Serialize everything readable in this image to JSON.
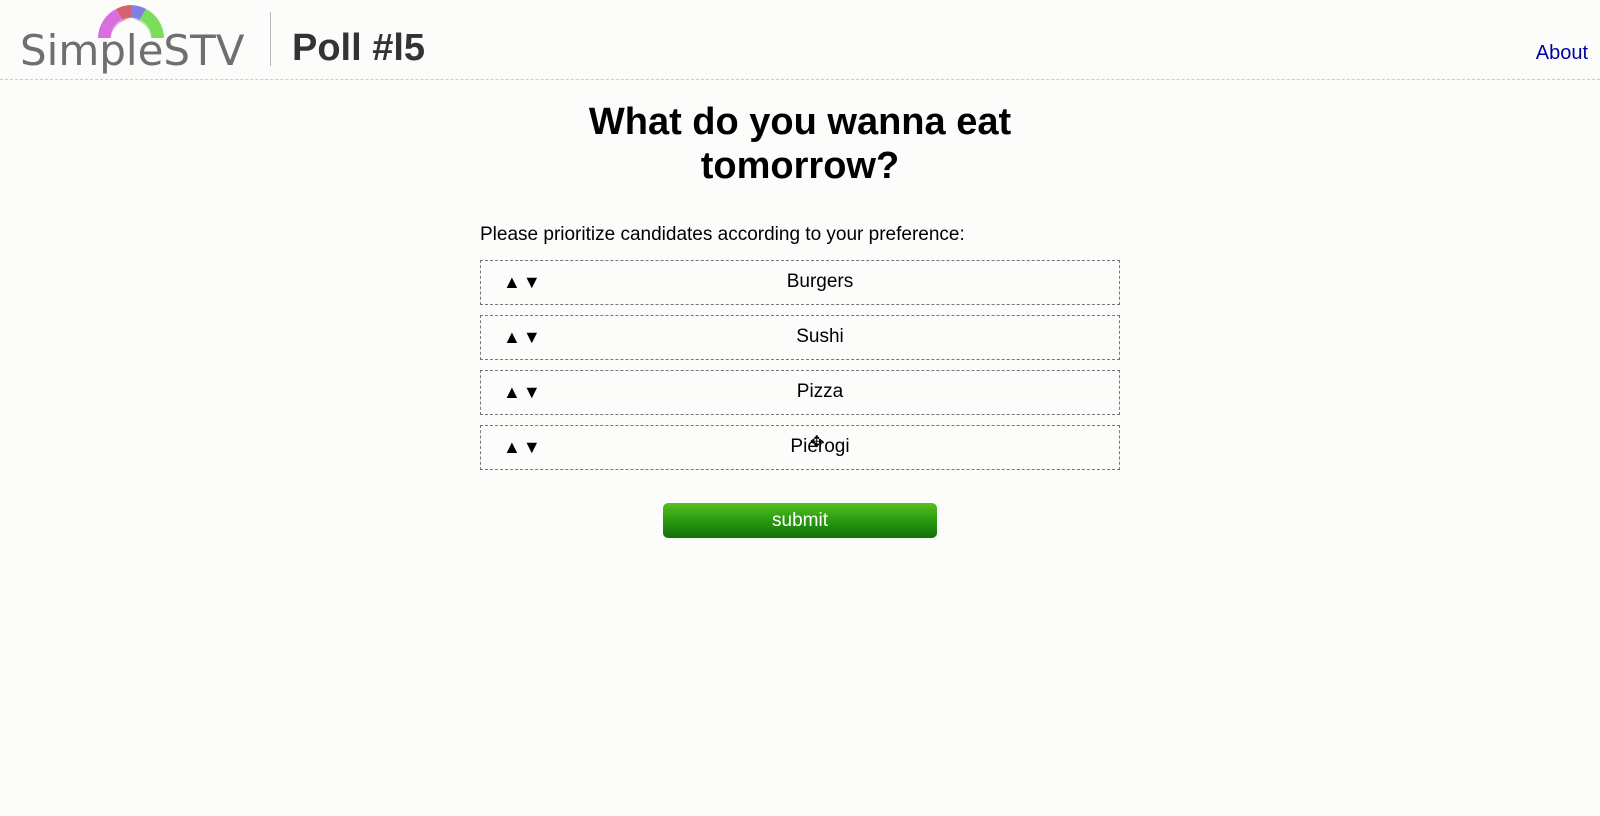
{
  "header": {
    "logo_text": "SimpleSTV",
    "poll_title": "Poll #l5",
    "about_label": "About"
  },
  "poll": {
    "question_line1": "What do you wanna eat",
    "question_line2": "tomorrow?",
    "instructions": "Please prioritize candidates according to your preference:",
    "up_arrow": "▲",
    "down_arrow": "▼",
    "candidates": [
      {
        "name": "Burgers"
      },
      {
        "name": "Sushi"
      },
      {
        "name": "Pizza"
      },
      {
        "name": "Pierogi"
      }
    ],
    "submit_label": "submit"
  },
  "colors": {
    "link": "#0000aa",
    "submit_green": "#2a9a10",
    "logo_gray": "#6f6f6f"
  },
  "icons": {
    "logo_arc": "rainbow-arc-icon",
    "cursor": "move-cursor-icon"
  }
}
